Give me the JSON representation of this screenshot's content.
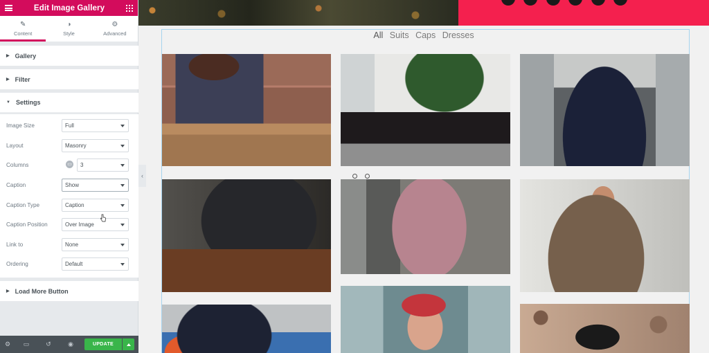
{
  "panel": {
    "title": "Edit Image Gallery",
    "header_color": "#d30c5c",
    "tabs": [
      {
        "label": "Content",
        "icon": "pencil-icon",
        "active": true
      },
      {
        "label": "Style",
        "icon": "half-circle-icon",
        "active": false
      },
      {
        "label": "Advanced",
        "icon": "gear-icon",
        "active": false
      }
    ],
    "sections": {
      "gallery": "Gallery",
      "filter": "Filter",
      "settings": "Settings",
      "load_more": "Load More Button"
    },
    "settings": {
      "image_size": {
        "label": "Image Size",
        "value": "Full"
      },
      "layout": {
        "label": "Layout",
        "value": "Masonry"
      },
      "columns": {
        "label": "Columns",
        "value": "3"
      },
      "caption": {
        "label": "Caption",
        "value": "Show"
      },
      "caption_type": {
        "label": "Caption Type",
        "value": "Caption"
      },
      "caption_position": {
        "label": "Caption Position",
        "value": "Over Image"
      },
      "link_to": {
        "label": "Link to",
        "value": "None"
      },
      "ordering": {
        "label": "Ordering",
        "value": "Default"
      }
    },
    "footer": {
      "update_label": "UPDATE",
      "update_color": "#39b54a"
    }
  },
  "preview": {
    "hero_accent": "#f4204e",
    "filters": [
      "All",
      "Suits",
      "Caps",
      "Dresses"
    ],
    "gallery_images": [
      "man-plaid-suit-bench",
      "man-suit-armchair-tree",
      "man-navy-suit-stairs",
      "man-suit-coffee-cup",
      "man-pink-blazer",
      "man-tweed-jacket-backpack",
      "man-snapback-cap",
      "woman-floral-cap",
      "man-black-cap-leaves"
    ]
  }
}
